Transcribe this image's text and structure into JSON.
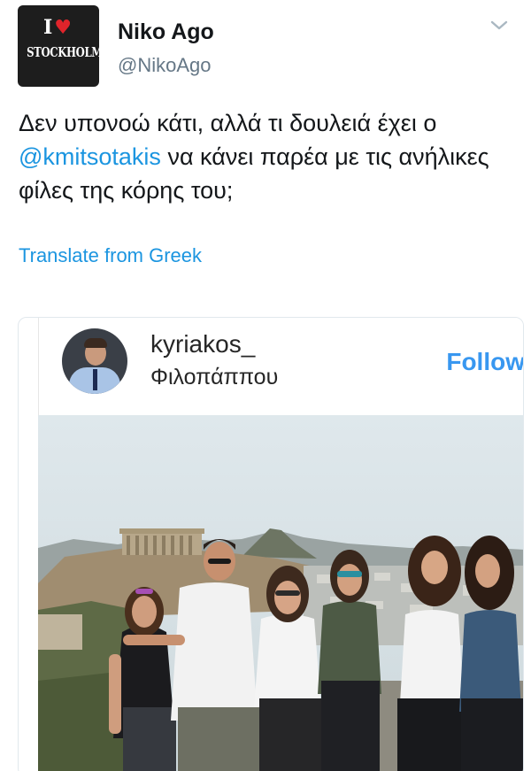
{
  "tweet": {
    "avatar": {
      "line1_left": "I",
      "line1_right": "",
      "line2": "STOCKHOLM",
      "icon": "heart-icon"
    },
    "display_name": "Niko Ago",
    "handle": "@NikoAgo",
    "text_before": "Δεν υπονοώ κάτι, αλλά τι δουλειά έχει ο ",
    "mention": "@kmitsotakis",
    "text_after": " να κάνει παρέα με τις ανήλικες φίλες της κόρης του;",
    "translate_label": "Translate from Greek"
  },
  "instagram": {
    "username": "kyriakos_",
    "location": "Φιλοπάππου",
    "follow_label": "Follow"
  },
  "colors": {
    "link": "#1b95e0",
    "instagram_blue": "#3897f0",
    "text": "#14171a",
    "muted": "#657786"
  }
}
